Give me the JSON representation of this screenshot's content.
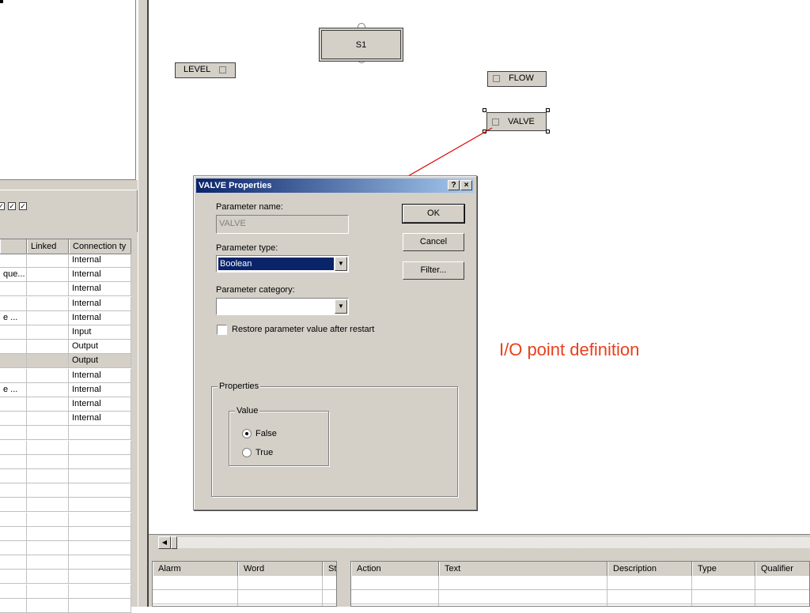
{
  "left_panel": {
    "columns": [
      "",
      "Linked",
      "Connection ty"
    ],
    "rows": [
      {
        "name": "",
        "linked": "",
        "connection": "Internal"
      },
      {
        "name": "que...",
        "linked": "",
        "connection": "Internal"
      },
      {
        "name": "",
        "linked": "",
        "connection": "Internal"
      },
      {
        "name": "",
        "linked": "",
        "connection": "Internal"
      },
      {
        "name": "e ...",
        "linked": "",
        "connection": "Internal"
      },
      {
        "name": "",
        "linked": "",
        "connection": "Input"
      },
      {
        "name": "",
        "linked": "",
        "connection": "Output"
      },
      {
        "name": "",
        "linked": "",
        "connection": "Output"
      },
      {
        "name": "",
        "linked": "",
        "connection": "Internal"
      },
      {
        "name": "e ...",
        "linked": "",
        "connection": "Internal"
      },
      {
        "name": "",
        "linked": "",
        "connection": "Internal"
      },
      {
        "name": "",
        "linked": "",
        "connection": "Internal"
      },
      {
        "name": "",
        "linked": "",
        "connection": ""
      },
      {
        "name": "",
        "linked": "",
        "connection": ""
      },
      {
        "name": "",
        "linked": "",
        "connection": ""
      },
      {
        "name": "",
        "linked": "",
        "connection": ""
      },
      {
        "name": "",
        "linked": "",
        "connection": ""
      },
      {
        "name": "",
        "linked": "",
        "connection": ""
      },
      {
        "name": "",
        "linked": "",
        "connection": ""
      },
      {
        "name": "",
        "linked": "",
        "connection": ""
      },
      {
        "name": "",
        "linked": "",
        "connection": ""
      },
      {
        "name": "",
        "linked": "",
        "connection": ""
      },
      {
        "name": "",
        "linked": "",
        "connection": ""
      },
      {
        "name": "",
        "linked": "",
        "connection": ""
      },
      {
        "name": "",
        "linked": "",
        "connection": ""
      }
    ],
    "selected_row": 7
  },
  "canvas": {
    "step_label": "S1",
    "blocks": {
      "level": "LEVEL",
      "flow": "FLOW",
      "valve": "VALVE"
    },
    "annotation": "I/O point definition",
    "annotation_color": "#e8401c"
  },
  "dialog": {
    "title": "VALVE Properties",
    "help_button": "?",
    "close_button": "×",
    "param_name_label": "Parameter name:",
    "param_name_value": "VALVE",
    "param_type_label": "Parameter type:",
    "param_type_value": "Boolean",
    "param_category_label": "Parameter category:",
    "param_category_value": "",
    "restore_label": "Restore parameter value after restart",
    "restore_checked": false,
    "ok": "OK",
    "cancel": "Cancel",
    "filter": "Filter...",
    "properties_group": "Properties",
    "value_group": "Value",
    "radio_false": "False",
    "radio_true": "True",
    "selected_value": "False"
  },
  "bottom": {
    "alarm_columns": [
      "Alarm",
      "Word",
      "St"
    ],
    "action_columns": [
      "Action",
      "Text",
      "Description",
      "Type",
      "Qualifier"
    ]
  },
  "colors": {
    "titlebar_start": "#0a246a",
    "titlebar_end": "#a6caf0",
    "face": "#d4d0c8",
    "arrow": "#e00000"
  }
}
